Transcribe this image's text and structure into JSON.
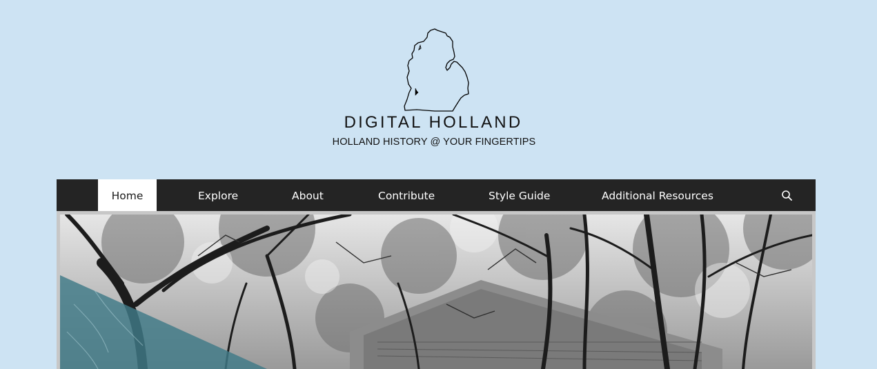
{
  "header": {
    "logo_icon": "michigan-map-icon",
    "title": "DIGITAL HOLLAND",
    "tagline": "HOLLAND HISTORY @ YOUR FINGERTIPS"
  },
  "nav": {
    "items": [
      {
        "label": "Home",
        "active": true
      },
      {
        "label": "Explore",
        "active": false
      },
      {
        "label": "About",
        "active": false
      },
      {
        "label": "Contribute",
        "active": false
      },
      {
        "label": "Style Guide",
        "active": false
      },
      {
        "label": "Additional Resources",
        "active": false
      }
    ],
    "search_icon": "search-icon"
  },
  "colors": {
    "background": "#cde3f3",
    "nav_background": "#242424",
    "nav_active_background": "#ffffff",
    "accent_teal": "#3f7a87"
  },
  "hero": {
    "image": "black-and-white photo of trees and a house roof"
  }
}
